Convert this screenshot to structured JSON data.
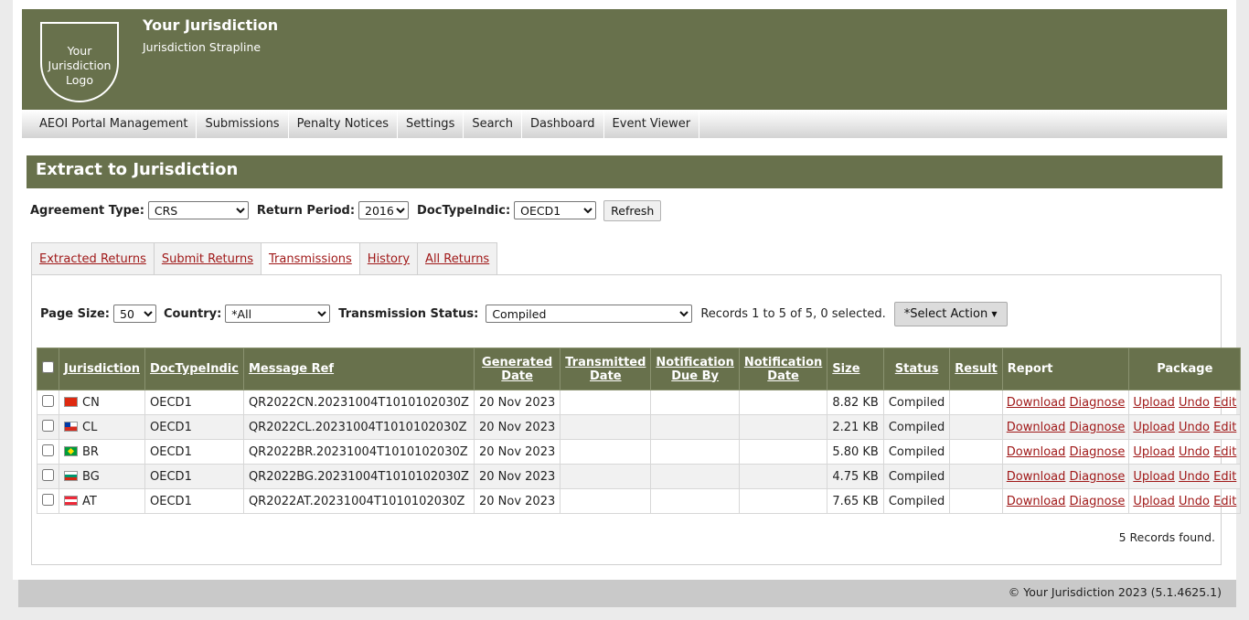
{
  "header": {
    "logo_lines": [
      "Your",
      "Jurisdiction",
      "Logo"
    ],
    "title": "Your Jurisdiction",
    "strapline": "Jurisdiction Strapline"
  },
  "nav": [
    "AEOI Portal Management",
    "Submissions",
    "Penalty Notices",
    "Settings",
    "Search",
    "Dashboard",
    "Event Viewer"
  ],
  "page_title": "Extract to Jurisdiction",
  "filters": {
    "agreement_type_label": "Agreement Type:",
    "agreement_type_value": "CRS",
    "return_period_label": "Return Period:",
    "return_period_value": "2016",
    "doctypeindic_label": "DocTypeIndic:",
    "doctypeindic_value": "OECD1",
    "refresh_label": "Refresh"
  },
  "tabs": [
    {
      "label": "Extracted Returns",
      "active": false
    },
    {
      "label": "Submit Returns",
      "active": false
    },
    {
      "label": "Transmissions",
      "active": true
    },
    {
      "label": "History",
      "active": false
    },
    {
      "label": "All Returns",
      "active": false
    }
  ],
  "panel_filters": {
    "page_size_label": "Page Size:",
    "page_size_value": "50",
    "country_label": "Country:",
    "country_value": "*All",
    "status_label": "Transmission Status:",
    "status_value": "Compiled",
    "records_text": "Records 1 to 5 of 5, 0 selected.",
    "action_label": "*Select Action"
  },
  "table": {
    "headers": {
      "jurisdiction": "Jurisdiction",
      "doctypeindic": "DocTypeIndic",
      "message_ref": "Message Ref",
      "generated_1": "Generated",
      "generated_2": "Date",
      "transmitted_1": "Transmitted",
      "transmitted_2": "Date",
      "notif_due_1": "Notification",
      "notif_due_2": "Due By",
      "notif_date_1": "Notification",
      "notif_date_2": "Date",
      "size": "Size",
      "status": "Status",
      "result": "Result",
      "report": "Report",
      "package": "Package"
    },
    "links": {
      "download": "Download",
      "diagnose": "Diagnose",
      "upload": "Upload",
      "undo": "Undo",
      "edit": "Edit"
    },
    "rows": [
      {
        "code": "CN",
        "doctype": "OECD1",
        "message_ref": "QR2022CN.20231004T1010102030Z",
        "generated": "20 Nov 2023",
        "transmitted": "",
        "due_by": "",
        "notif_date": "",
        "size": "8.82 KB",
        "status": "Compiled",
        "result": ""
      },
      {
        "code": "CL",
        "doctype": "OECD1",
        "message_ref": "QR2022CL.20231004T1010102030Z",
        "generated": "20 Nov 2023",
        "transmitted": "",
        "due_by": "",
        "notif_date": "",
        "size": "2.21 KB",
        "status": "Compiled",
        "result": ""
      },
      {
        "code": "BR",
        "doctype": "OECD1",
        "message_ref": "QR2022BR.20231004T1010102030Z",
        "generated": "20 Nov 2023",
        "transmitted": "",
        "due_by": "",
        "notif_date": "",
        "size": "5.80 KB",
        "status": "Compiled",
        "result": ""
      },
      {
        "code": "BG",
        "doctype": "OECD1",
        "message_ref": "QR2022BG.20231004T1010102030Z",
        "generated": "20 Nov 2023",
        "transmitted": "",
        "due_by": "",
        "notif_date": "",
        "size": "4.75 KB",
        "status": "Compiled",
        "result": ""
      },
      {
        "code": "AT",
        "doctype": "OECD1",
        "message_ref": "QR2022AT.20231004T1010102030Z",
        "generated": "20 Nov 2023",
        "transmitted": "",
        "due_by": "",
        "notif_date": "",
        "size": "7.65 KB",
        "status": "Compiled",
        "result": ""
      }
    ]
  },
  "records_found": "5 Records found.",
  "footer": "© Your Jurisdiction 2023 (5.1.4625.1)",
  "colors": {
    "banner": "#68714c",
    "link": "#a01919"
  }
}
